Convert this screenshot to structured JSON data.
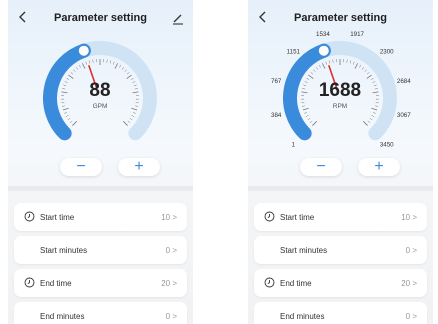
{
  "screens": [
    {
      "title": "Parameter setting",
      "gauge": {
        "value": "88",
        "unit": "GPM",
        "fraction": 0.43,
        "ticks": []
      },
      "rows": [
        {
          "label": "Start time",
          "value": "10",
          "icon": "clock-icon"
        },
        {
          "label": "Start minutes",
          "value": "0",
          "icon": ""
        },
        {
          "label": "End time",
          "value": "20",
          "icon": "clock-icon"
        },
        {
          "label": "End minutes",
          "value": "0",
          "icon": ""
        }
      ],
      "minus_label": "−",
      "plus_label": "+",
      "chevron": ">"
    },
    {
      "title": "Parameter setting",
      "gauge": {
        "value": "1688",
        "unit": "RPM",
        "fraction": 0.43,
        "ticks": [
          "1",
          "384",
          "767",
          "1151",
          "1534",
          "1917",
          "2300",
          "2684",
          "3067",
          "3450"
        ]
      },
      "rows": [
        {
          "label": "Start time",
          "value": "10",
          "icon": "clock-icon"
        },
        {
          "label": "Start minutes",
          "value": "0",
          "icon": ""
        },
        {
          "label": "End time",
          "value": "20",
          "icon": "clock-icon"
        },
        {
          "label": "End minutes",
          "value": "0",
          "icon": ""
        }
      ],
      "minus_label": "−",
      "plus_label": "+",
      "chevron": ">"
    }
  ],
  "colors": {
    "accent": "#3b8bdd",
    "track": "#cfe3f5",
    "needle": "#d9312b"
  }
}
